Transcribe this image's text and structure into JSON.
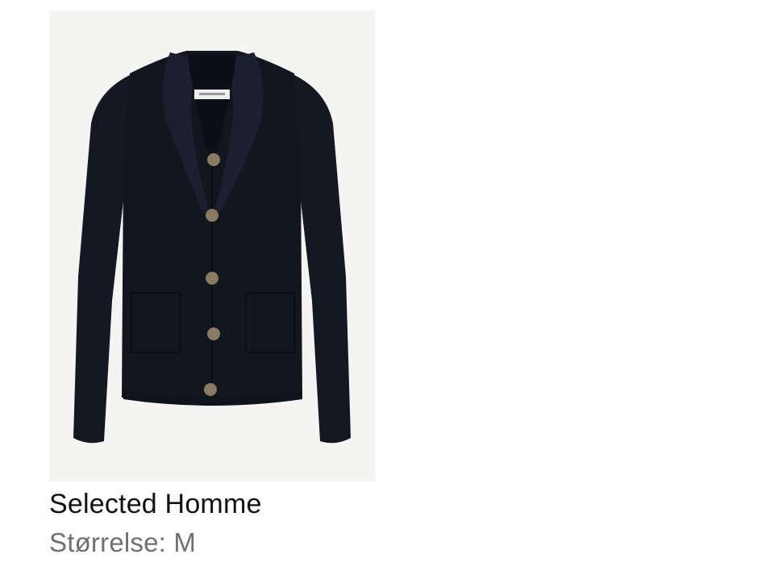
{
  "product": {
    "brand": "Selected Homme",
    "size_label": "Størrelse:",
    "size_value": "M",
    "image_icon": "cardigan-photo",
    "colors": {
      "garment": "#12161f",
      "background": "#f4f4f3",
      "button": "#8a7a62",
      "size_text": "#707070",
      "brand_text": "#121212"
    }
  }
}
